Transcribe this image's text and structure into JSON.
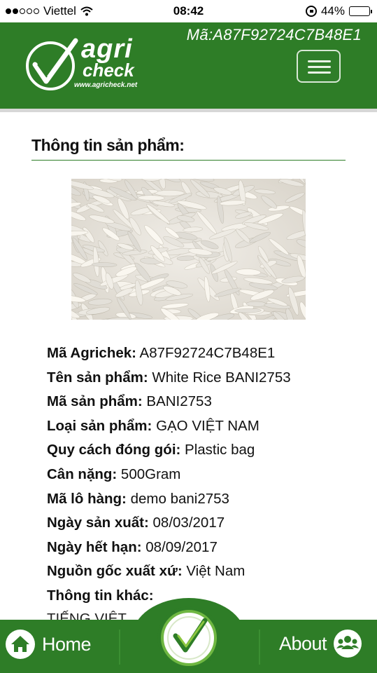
{
  "status_bar": {
    "carrier": "Viettel",
    "time": "08:42",
    "battery": "44%",
    "battery_level": 0.44
  },
  "header": {
    "code": "Mã:A87F92724C7B48E1",
    "logo": {
      "word1": "agri",
      "word2": "check",
      "url": "www.agricheck.net"
    }
  },
  "section": {
    "title": "Thông tin sản phẩm:"
  },
  "product": {
    "image_alt": "white rice grains",
    "fields": [
      {
        "label": "Mã Agrichek:",
        "value": "A87F92724C7B48E1"
      },
      {
        "label": "Tên sản phẩm:",
        "value": "White Rice BANI2753"
      },
      {
        "label": "Mã sản phẩm:",
        "value": "BANI2753"
      },
      {
        "label": "Loại sản phẩm:",
        "value": "GẠO VIỆT NAM"
      },
      {
        "label": "Quy cách đóng gói:",
        "value": "Plastic bag"
      },
      {
        "label": "Cân nặng:",
        "value": "500Gram"
      },
      {
        "label": "Mã lô hàng:",
        "value": "demo bani2753"
      },
      {
        "label": "Ngày sản xuất:",
        "value": "08/03/2017"
      },
      {
        "label": "Ngày hết hạn:",
        "value": "08/09/2017"
      },
      {
        "label": "Nguồn gốc xuất xứ:",
        "value": "Việt Nam"
      },
      {
        "label": "Thông tin khác:",
        "value": ""
      }
    ],
    "extra_text": "TIẾNG VIỆT"
  },
  "bottom_nav": {
    "home_label": "Home",
    "about_label": "About"
  },
  "colors": {
    "brand_green": "#2e7d27",
    "check_green": "#8cc63f"
  },
  "icons": [
    "wifi-icon",
    "rotation-lock-icon",
    "battery-icon",
    "menu-icon",
    "home-icon",
    "people-icon",
    "checkmark-logo-icon"
  ]
}
